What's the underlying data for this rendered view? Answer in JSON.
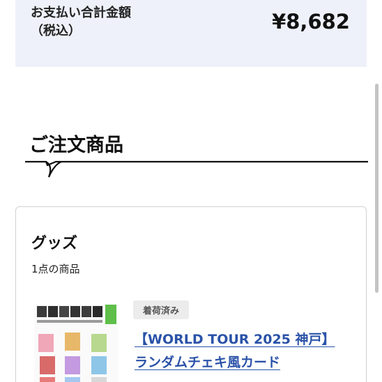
{
  "total": {
    "label_line1": "お支払い合計金額",
    "label_line2": "（税込）",
    "amount": "¥8,682"
  },
  "section": {
    "title": "ご注文商品"
  },
  "order": {
    "category": "グッズ",
    "item_count": "1点の商品",
    "items": [
      {
        "status": "着荷済み",
        "name_line1": "【WORLD TOUR 2025 神戸】",
        "name_line2": "ランダムチェキ風カード"
      }
    ]
  },
  "colors": {
    "total_bg": "#eef1fa",
    "link": "#2a52a8",
    "badge_bg": "#ececec"
  }
}
